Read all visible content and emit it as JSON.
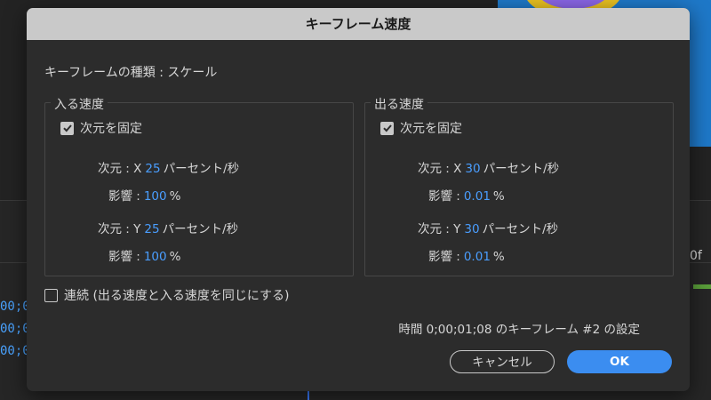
{
  "dialog": {
    "title": "キーフレーム速度",
    "keyframe_type": "キーフレームの種類 : スケール"
  },
  "incoming": {
    "legend": "入る速度",
    "lock_label": "次元を固定",
    "lock_checked": true,
    "dim_x_label": "次元 : X",
    "dim_x_value": "25",
    "dim_y_label": "次元 : Y",
    "dim_y_value": "25",
    "unit": "パーセント/秒",
    "influence_label": "影響 :",
    "influence_x_value": "100",
    "influence_y_value": "100",
    "percent": "%"
  },
  "outgoing": {
    "legend": "出る速度",
    "lock_label": "次元を固定",
    "lock_checked": true,
    "dim_x_label": "次元 : X",
    "dim_x_value": "30",
    "dim_y_label": "次元 : Y",
    "dim_y_value": "30",
    "unit": "パーセント/秒",
    "influence_label": "影響 :",
    "influence_x_value": "0.01",
    "influence_y_value": "0.01",
    "percent": "%"
  },
  "continuous": {
    "label": "連続 (出る速度と入る速度を同じにする)",
    "checked": false
  },
  "status": "時間 0;00;01;08 のキーフレーム #2 の設定",
  "buttons": {
    "cancel": "キャンセル",
    "ok": "OK"
  },
  "background": {
    "timecode_rows": [
      "00;0",
      "00;0",
      "00;0"
    ],
    "frame_label": "0f"
  },
  "colors": {
    "accent": "#3b8df0",
    "value_text": "#4a9eff",
    "title_bar": "#c9c9c9",
    "dialog_bg": "#2c2c2c"
  }
}
